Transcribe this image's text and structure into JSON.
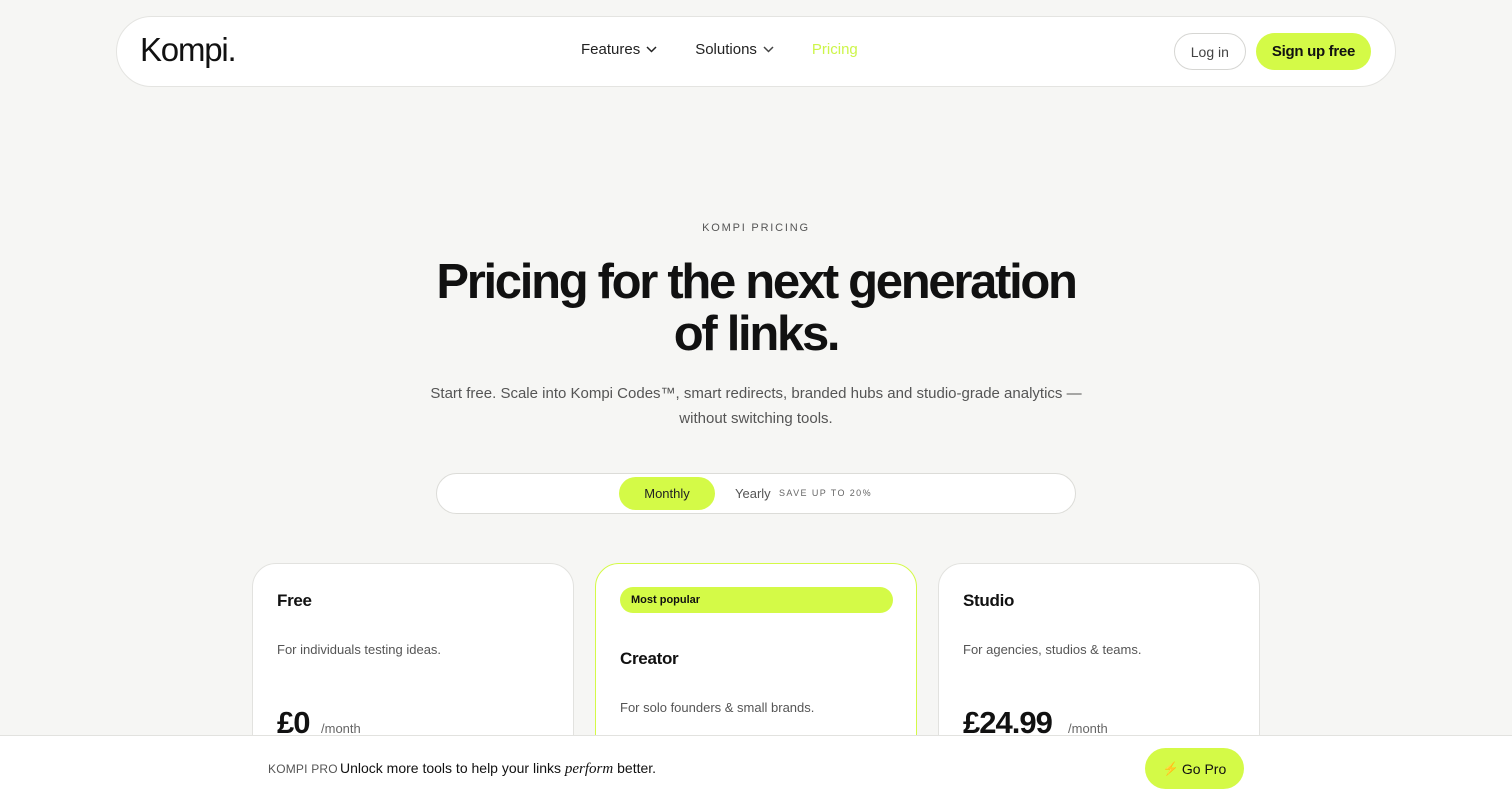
{
  "brand": {
    "logo": "Kompi."
  },
  "nav": {
    "links": [
      {
        "label": "Features"
      },
      {
        "label": "Solutions"
      },
      {
        "label": "Pricing"
      }
    ],
    "login": "Log in",
    "signup": "Sign up free"
  },
  "hero": {
    "eyebrow": "KOMPI PRICING",
    "title_line1": "Pricing for the next generation",
    "title_line2": "of links.",
    "subtitle_line1": "Start free. Scale into Kompi Codes™, smart redirects, branded hubs and studio-grade analytics —",
    "subtitle_line2": "without switching tools."
  },
  "billing_toggle": {
    "monthly": "Monthly",
    "yearly": "Yearly",
    "yearly_note": "SAVE UP TO 20%",
    "selected": "Monthly"
  },
  "plans": [
    {
      "name": "Free",
      "description": "For individuals testing ideas.",
      "price": "£0",
      "per": "/month"
    },
    {
      "badge": "Most popular",
      "name": "Creator",
      "description": "For solo founders & small brands."
    },
    {
      "name": "Studio",
      "description": "For agencies, studios & teams.",
      "price": "£24.99",
      "per": "/month"
    }
  ],
  "promo_bar": {
    "tag": "KOMPI PRO",
    "text_before": "Unlock more tools to help your links",
    "text_emphasis": "perform",
    "text_after": "better.",
    "button": "Go Pro",
    "button_icon": "⚡"
  },
  "colors": {
    "accent": "#d4fa47",
    "active_link": "#cdf54a",
    "background": "#f6f6f4"
  }
}
